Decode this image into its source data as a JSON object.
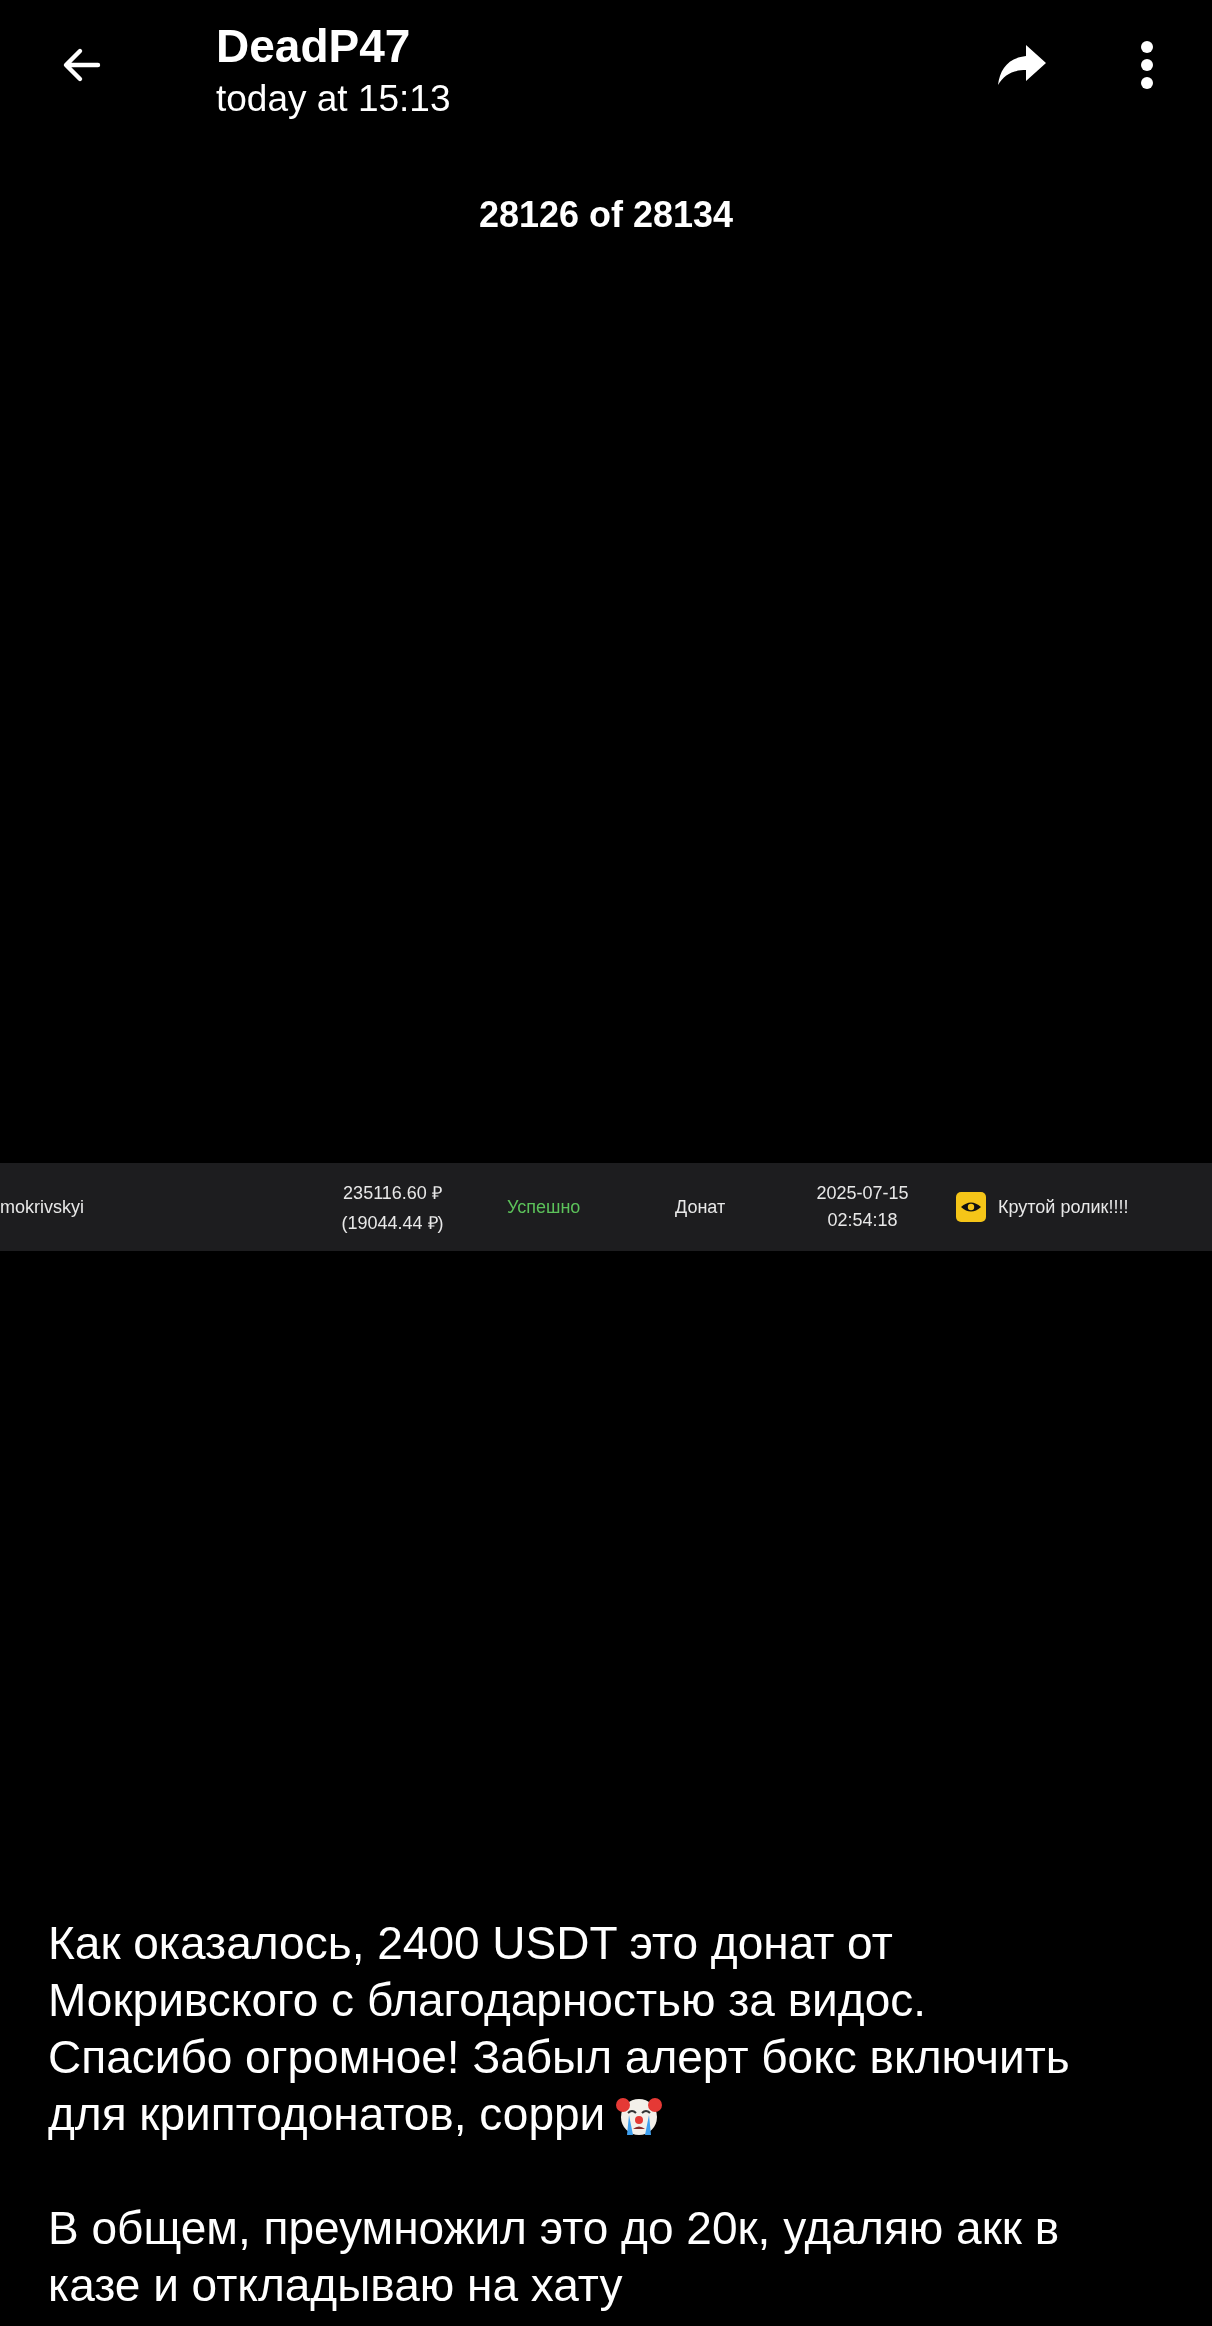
{
  "header": {
    "title": "DeadP47",
    "subtitle": "today at 15:13"
  },
  "counter": "28126 of 28134",
  "photo": {
    "row": {
      "user": "mokrivskyi",
      "amount": "235116.60 ₽",
      "amount_converted": "(19044.44 ₽)",
      "status": "Успешно",
      "type": "Донат",
      "date": "2025-07-15",
      "time": "02:54:18",
      "comment": "Крутой ролик!!!!"
    }
  },
  "caption": {
    "paragraphs": [
      {
        "lines": [
          {
            "text": "Как оказалось, 2400 USDT это донат от",
            "kind": "text"
          },
          {
            "text": "Мокривского с благодарностью за видос.",
            "kind": "text"
          },
          {
            "text": "Спасибо огромное! Забыл алерт бокс включить",
            "kind": "text"
          },
          {
            "text": "для криптодонатов, сорри",
            "kind": "text_with_emoji"
          }
        ]
      },
      {
        "lines": [
          {
            "text": "В общем, преумножил это до 20к, удаляю акк в",
            "kind": "text"
          },
          {
            "text": "казе и откладываю на хату",
            "kind": "text"
          }
        ]
      }
    ]
  }
}
